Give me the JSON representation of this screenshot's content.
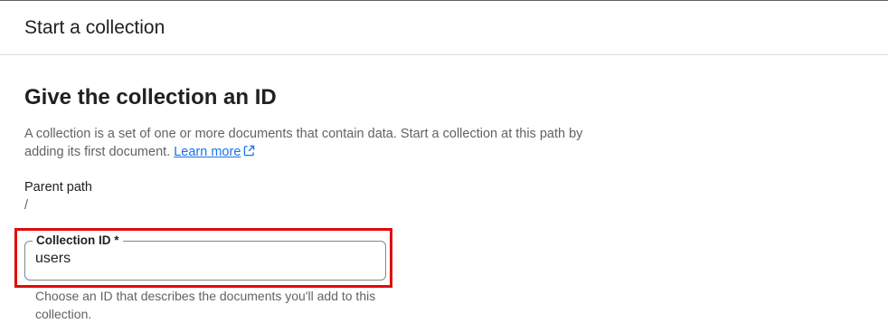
{
  "dialog": {
    "title": "Start a collection"
  },
  "section": {
    "heading": "Give the collection an ID",
    "description": "A collection is a set of one or more documents that contain data. Start a collection at this path by adding its first document.",
    "learn_more_label": "Learn more"
  },
  "parent_path": {
    "label": "Parent path",
    "value": "/"
  },
  "collection_id_field": {
    "label": "Collection ID *",
    "value": "users",
    "hint": "Choose an ID that describes the documents you'll add to this collection."
  },
  "colors": {
    "highlight_border": "#e10a0a",
    "link": "#1a73e8"
  }
}
